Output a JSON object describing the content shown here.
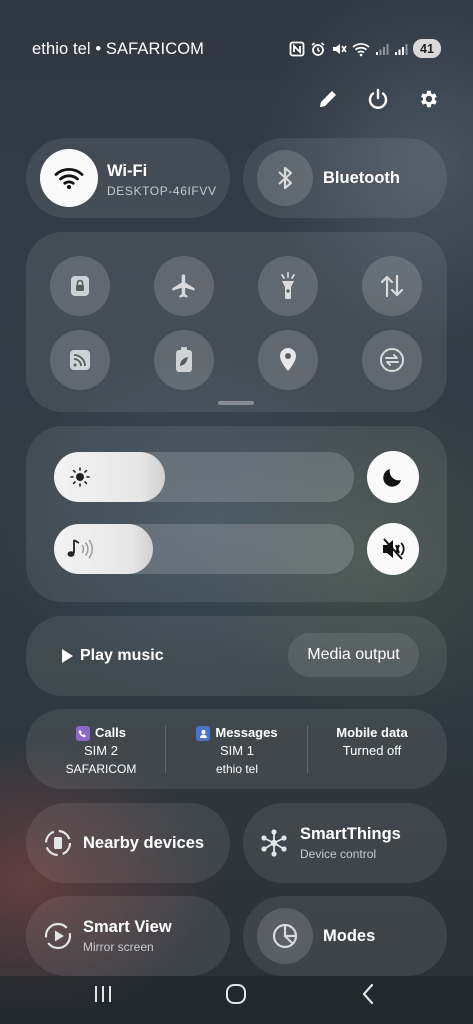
{
  "status_bar": {
    "carrier": "ethio tel • SAFARICOM",
    "battery": "41",
    "icons": [
      "nfc-icon",
      "alarm-icon",
      "mute-icon",
      "wifi-icon",
      "signal-sim1-icon",
      "signal-sim2-icon",
      "battery-icon"
    ]
  },
  "header_actions": [
    "edit-icon",
    "power-icon",
    "settings-icon"
  ],
  "connectivity": {
    "wifi": {
      "label": "Wi-Fi",
      "network": "DESKTOP-46IFVV",
      "active": true
    },
    "bluetooth": {
      "label": "Bluetooth",
      "active": false
    }
  },
  "quick_toggles": [
    {
      "icon": "secure-folder-icon"
    },
    {
      "icon": "airplane-icon"
    },
    {
      "icon": "flashlight-icon"
    },
    {
      "icon": "mobile-data-icon"
    },
    {
      "icon": "cast-icon"
    },
    {
      "icon": "power-saving-icon"
    },
    {
      "icon": "location-icon"
    },
    {
      "icon": "sync-icon"
    }
  ],
  "sliders": {
    "brightness": {
      "icon": "sun-icon",
      "level": 0.37,
      "toggle_icon": "dark-mode-icon"
    },
    "volume": {
      "icon": "sound-icon",
      "level": 0.33,
      "toggle_icon": "mute-icon"
    }
  },
  "media": {
    "play_label": "Play music",
    "output_label": "Media output"
  },
  "sim_info": {
    "calls": {
      "label": "Calls",
      "sim": "SIM 2",
      "carrier": "SAFARICOM",
      "color": "#8a67c9"
    },
    "messages": {
      "label": "Messages",
      "sim": "SIM 1",
      "carrier": "ethio tel",
      "color": "#4a73c9"
    },
    "mobile_data": {
      "label": "Mobile data",
      "status": "Turned off"
    }
  },
  "bottom_tiles": {
    "nearby": {
      "label": "Nearby devices"
    },
    "smartthings": {
      "label": "SmartThings",
      "sub": "Device control"
    },
    "smartview": {
      "label": "Smart View",
      "sub": "Mirror screen"
    },
    "modes": {
      "label": "Modes"
    }
  },
  "nav_bar": [
    "recents-icon",
    "home-icon",
    "back-icon"
  ],
  "colors": {
    "background": "#323b43",
    "tile": "#ffffff16",
    "active": "#ffffff"
  }
}
